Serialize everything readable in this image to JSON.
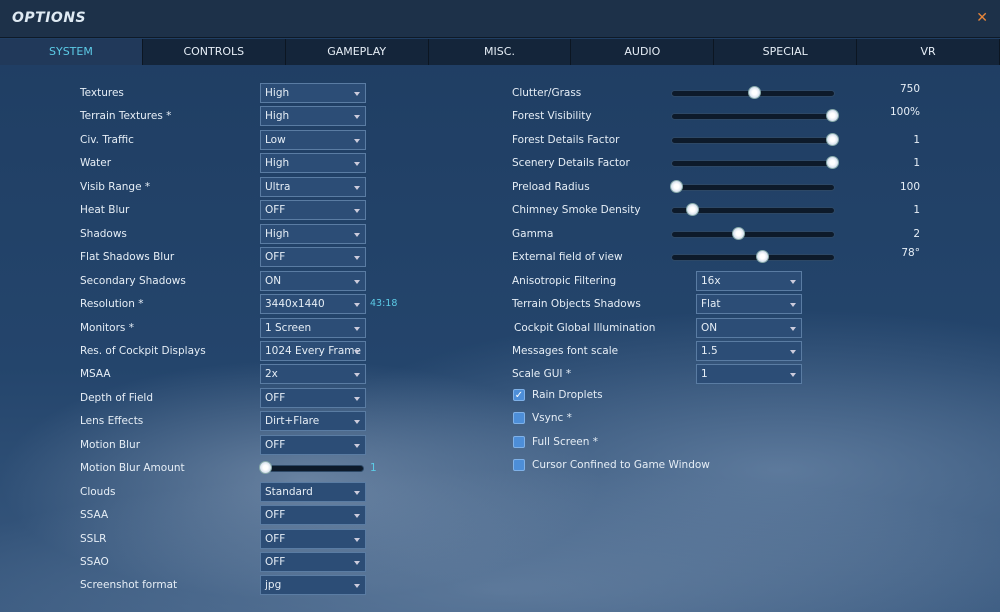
{
  "title": "OPTIONS",
  "tabs": [
    "SYSTEM",
    "CONTROLS",
    "GAMEPLAY",
    "MISC.",
    "AUDIO",
    "SPECIAL",
    "VR"
  ],
  "left": [
    {
      "label": "Textures",
      "value": "High"
    },
    {
      "label": "Terrain Textures *",
      "value": "High"
    },
    {
      "label": "Civ. Traffic",
      "value": "Low"
    },
    {
      "label": "Water",
      "value": "High"
    },
    {
      "label": "Visib Range *",
      "value": "Ultra"
    },
    {
      "label": "Heat Blur",
      "value": "OFF"
    },
    {
      "label": "Shadows",
      "value": "High"
    },
    {
      "label": "Flat Shadows Blur",
      "value": "OFF"
    },
    {
      "label": "Secondary Shadows",
      "value": "ON"
    },
    {
      "label": "Resolution *",
      "value": "3440x1440"
    },
    {
      "label": "Monitors *",
      "value": "1 Screen"
    },
    {
      "label": "Res. of Cockpit Displays",
      "value": "1024 Every Frame"
    },
    {
      "label": "MSAA",
      "value": "2x"
    },
    {
      "label": "Depth of Field",
      "value": "OFF"
    },
    {
      "label": "Lens Effects",
      "value": "Dirt+Flare"
    },
    {
      "label": "Motion Blur",
      "value": "OFF"
    },
    {
      "label": "Motion Blur Amount",
      "slider": 0,
      "value": "1"
    },
    {
      "label": "Clouds",
      "value": "Standard"
    },
    {
      "label": "SSAA",
      "value": "OFF"
    },
    {
      "label": "SSLR",
      "value": "OFF"
    },
    {
      "label": "SSAO",
      "value": "OFF"
    },
    {
      "label": "Screenshot format",
      "value": "jpg"
    }
  ],
  "aspect_ratio": "43:18",
  "sliders": [
    {
      "label": "Clutter/Grass",
      "value": "750",
      "pos": 0.5
    },
    {
      "label": "Forest Visibility",
      "value": "100%",
      "pos": 1
    },
    {
      "label": "Forest Details Factor",
      "value": "1",
      "pos": 1
    },
    {
      "label": "Scenery Details Factor",
      "value": "1",
      "pos": 1
    },
    {
      "label": "Preload Radius",
      "value": "100",
      "pos": 0
    },
    {
      "label": "Chimney Smoke Density",
      "value": "1",
      "pos": 0.1
    },
    {
      "label": "Gamma",
      "value": "2",
      "pos": 0.4
    },
    {
      "label": "External field of view",
      "value": "78°",
      "pos": 0.55
    }
  ],
  "right_dropdowns": [
    {
      "label": "Anisotropic Filtering",
      "value": "16x"
    },
    {
      "label": "Terrain Objects Shadows",
      "value": "Flat"
    },
    {
      "label": "Cockpit Global Illumination",
      "value": "ON"
    },
    {
      "label": "Messages font scale",
      "value": "1.5"
    },
    {
      "label": "Scale GUI *",
      "value": "1"
    }
  ],
  "checkboxes": [
    {
      "label": "Rain Droplets",
      "checked": true
    },
    {
      "label": "Vsync *",
      "checked": false
    },
    {
      "label": "Full Screen *",
      "checked": false
    },
    {
      "label": "Cursor Confined to Game Window",
      "checked": false
    }
  ]
}
